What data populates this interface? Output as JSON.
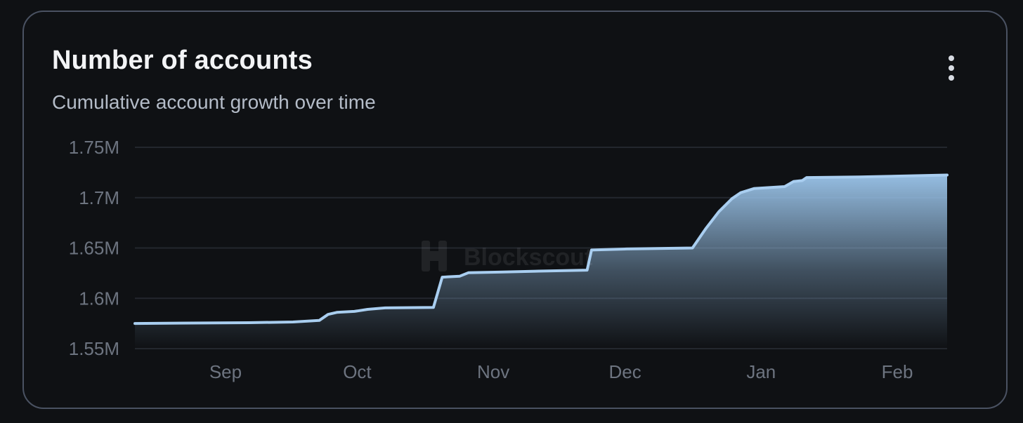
{
  "card": {
    "title": "Number of accounts",
    "subtitle": "Cumulative account growth over time",
    "menu_icon": "vertical-ellipsis-icon"
  },
  "watermark": {
    "text": "Blockscout",
    "icon": "blockscout-logo-icon"
  },
  "colors": {
    "line": "#a9cef0",
    "area_top": "#9cc6ec",
    "grid": "#23272e",
    "axis_text": "#6d7480",
    "border": "#4a5262",
    "background": "#0f1114"
  },
  "chart_data": {
    "type": "area",
    "title": "Number of accounts",
    "subtitle": "Cumulative account growth over time",
    "xlabel": "",
    "ylabel": "",
    "x_ticks": [
      "Sep",
      "Oct",
      "Nov",
      "Dec",
      "Jan",
      "Feb"
    ],
    "y_ticks": [
      1550000,
      1600000,
      1650000,
      1700000,
      1750000
    ],
    "y_tick_labels": [
      "1.55M",
      "1.6M",
      "1.65M",
      "1.7M",
      "1.75M"
    ],
    "ylim": [
      1550000,
      1750000
    ],
    "xlim": [
      "2024-08-20",
      "2025-02-21"
    ],
    "grid": true,
    "legend": "none",
    "series": [
      {
        "values": [
          {
            "x": "2024-08-20",
            "y": 1575000
          },
          {
            "x": "2024-09-15",
            "y": 1575800
          },
          {
            "x": "2024-09-25",
            "y": 1576500
          },
          {
            "x": "2024-10-01",
            "y": 1578000
          },
          {
            "x": "2024-10-03",
            "y": 1584000
          },
          {
            "x": "2024-10-05",
            "y": 1586000
          },
          {
            "x": "2024-10-09",
            "y": 1587000
          },
          {
            "x": "2024-10-12",
            "y": 1589000
          },
          {
            "x": "2024-10-16",
            "y": 1590500
          },
          {
            "x": "2024-10-27",
            "y": 1591000
          },
          {
            "x": "2024-10-29",
            "y": 1621000
          },
          {
            "x": "2024-11-02",
            "y": 1622000
          },
          {
            "x": "2024-11-04",
            "y": 1625500
          },
          {
            "x": "2024-11-11",
            "y": 1626000
          },
          {
            "x": "2024-11-20",
            "y": 1627000
          },
          {
            "x": "2024-12-01",
            "y": 1628000
          },
          {
            "x": "2024-12-02",
            "y": 1648000
          },
          {
            "x": "2024-12-10",
            "y": 1649000
          },
          {
            "x": "2024-12-25",
            "y": 1650000
          },
          {
            "x": "2024-12-28",
            "y": 1669000
          },
          {
            "x": "2024-12-31",
            "y": 1686000
          },
          {
            "x": "2025-01-03",
            "y": 1699000
          },
          {
            "x": "2025-01-05",
            "y": 1705000
          },
          {
            "x": "2025-01-08",
            "y": 1709000
          },
          {
            "x": "2025-01-15",
            "y": 1711000
          },
          {
            "x": "2025-01-17",
            "y": 1716000
          },
          {
            "x": "2025-01-19",
            "y": 1717000
          },
          {
            "x": "2025-01-20",
            "y": 1720000
          },
          {
            "x": "2025-02-01",
            "y": 1720500
          },
          {
            "x": "2025-02-21",
            "y": 1722500
          }
        ]
      }
    ]
  }
}
